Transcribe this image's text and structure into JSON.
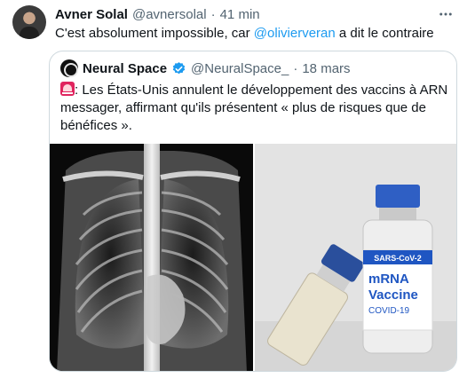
{
  "tweet": {
    "author_name": "Avner Solal",
    "handle": "@avnersolal",
    "separator": "·",
    "time": "41 min",
    "more_icon": "more-icon",
    "text_before": "C'est absolument impossible, car ",
    "mention": "@olivierveran",
    "text_after": " a dit le contraire"
  },
  "quote": {
    "author_name": "Neural Space",
    "handle": "@NeuralSpace_",
    "separator": "·",
    "date": "18 mars",
    "emoji_icon": "siren-icon",
    "text": ": Les États-Unis annulent le développement des vaccins à ARN messager, affirmant qu'ils présentent « plus de risques que de bénéfices ».",
    "vial_label": {
      "line1": "SARS-CoV-2",
      "line2": "mRNA",
      "line3": "Vaccine",
      "line4": "COVID-19"
    }
  },
  "colors": {
    "text": "#0f1419",
    "muted": "#536471",
    "accent": "#1d9bf0",
    "border": "#cfd9de"
  }
}
